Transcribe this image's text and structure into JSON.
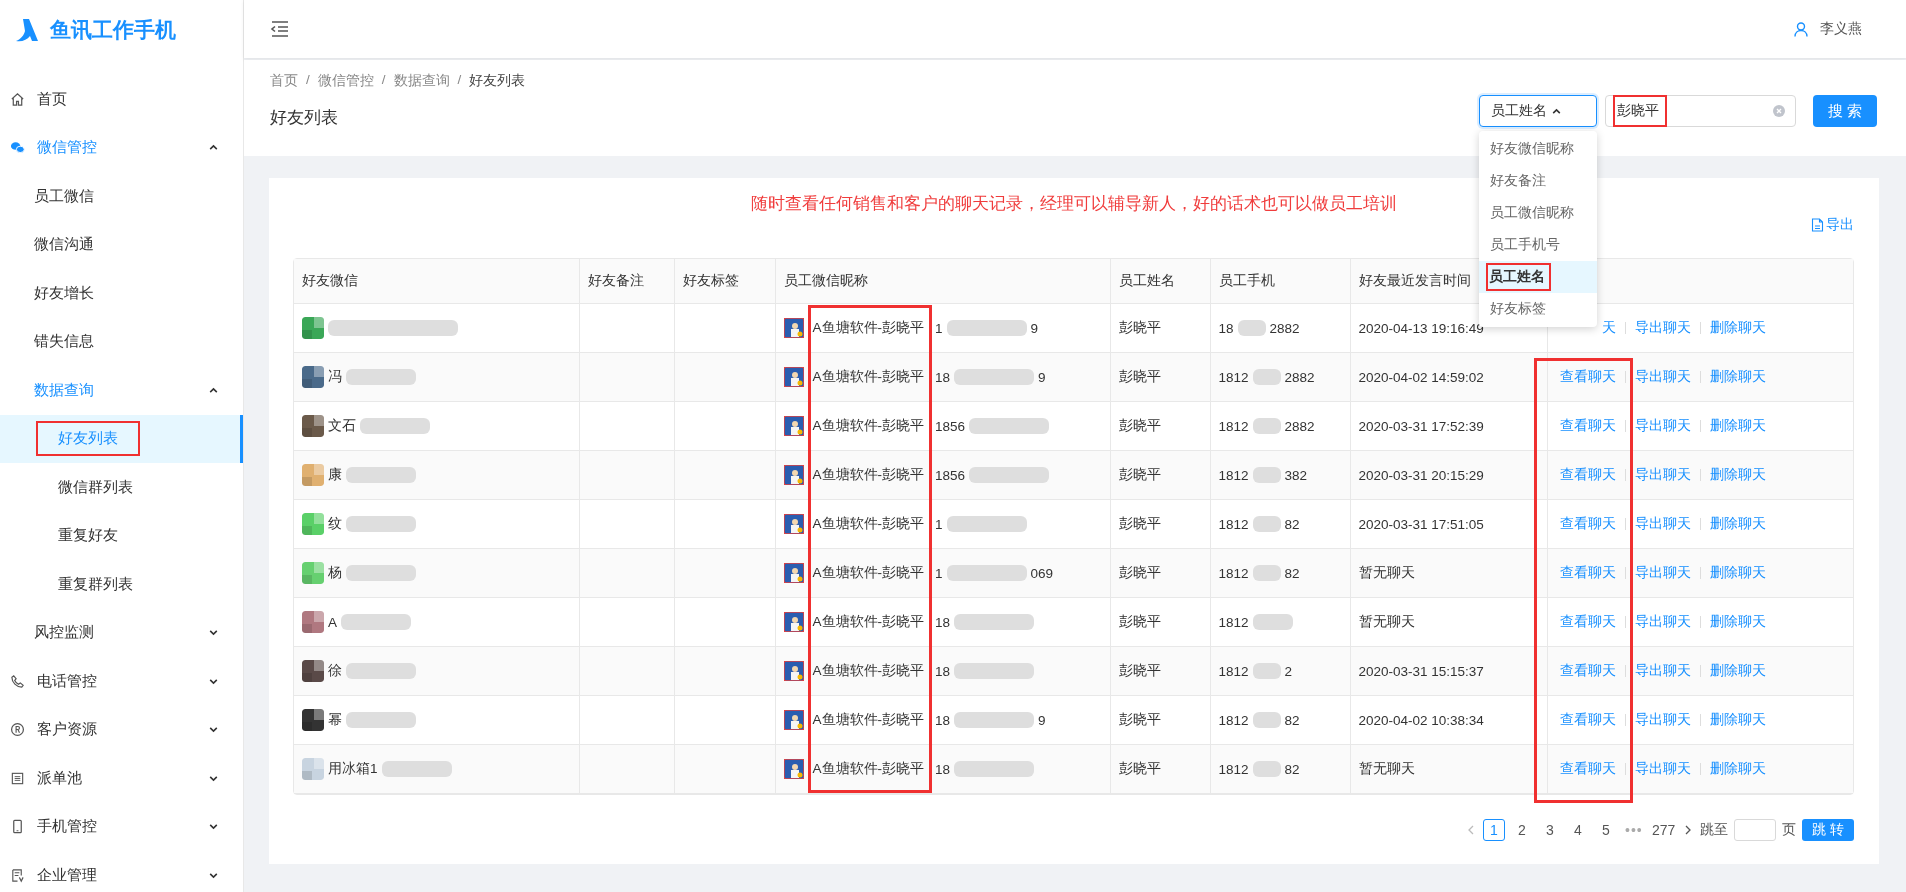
{
  "app": {
    "title": "鱼讯工作手机"
  },
  "sidebar": {
    "items": [
      {
        "label": "首页",
        "selected": false
      },
      {
        "label": "微信管控",
        "selected": false,
        "expanded": true,
        "children": [
          {
            "label": "员工微信",
            "selected": false
          },
          {
            "label": "微信沟通",
            "selected": false
          },
          {
            "label": "好友增长",
            "selected": false
          },
          {
            "label": "错失信息",
            "selected": false
          },
          {
            "label": "数据查询",
            "selected": false,
            "expanded": true,
            "children": [
              {
                "label": "好友列表",
                "selected": true,
                "highlighted": true
              },
              {
                "label": "微信群列表",
                "selected": false
              },
              {
                "label": "重复好友",
                "selected": false
              },
              {
                "label": "重复群列表",
                "selected": false
              }
            ]
          },
          {
            "label": "风控监测",
            "selected": false,
            "expanded": false
          }
        ]
      },
      {
        "label": "电话管控",
        "selected": false,
        "expanded": false
      },
      {
        "label": "客户资源",
        "selected": false,
        "expanded": false
      },
      {
        "label": "派单池",
        "selected": false,
        "expanded": false
      },
      {
        "label": "手机管控",
        "selected": false,
        "expanded": false
      },
      {
        "label": "企业管理",
        "selected": false,
        "expanded": false
      }
    ]
  },
  "header": {
    "user": "李义燕"
  },
  "breadcrumb": {
    "items": [
      "首页",
      "微信管控",
      "数据查询",
      "好友列表"
    ],
    "separators": [
      "/",
      "/",
      "/"
    ]
  },
  "page_title": "好友列表",
  "search": {
    "field": {
      "value": "员工姓名",
      "expanded": true,
      "options": [
        {
          "label": "好友微信昵称",
          "selected": false
        },
        {
          "label": "好友备注",
          "selected": false
        },
        {
          "label": "员工微信昵称",
          "selected": false
        },
        {
          "label": "员工手机号",
          "selected": false
        },
        {
          "label": "员工姓名",
          "selected": true,
          "highlighted": true
        },
        {
          "label": "好友标签",
          "selected": false
        }
      ]
    },
    "query": "彭晓平",
    "query_highlighted": true,
    "button": "搜 索"
  },
  "notice": "随时查看任何销售和客户的聊天记录，经理可以辅导新人，好的话术也可以做员工培训",
  "export": "导出",
  "table": {
    "columns": [
      {
        "label": "好友微信",
        "highlighted": false
      },
      {
        "label": "好友备注",
        "highlighted": false
      },
      {
        "label": "好友标签",
        "highlighted": false
      },
      {
        "label": "员工微信昵称",
        "highlighted": true
      },
      {
        "label": "员工姓名",
        "highlighted": false
      },
      {
        "label": "员工手机",
        "highlighted": false
      },
      {
        "label": "好友最近发言时间",
        "highlighted": false
      },
      {
        "highlighted": true
      }
    ],
    "rows": [
      {
        "nickname": {
          "text": "A鱼塘软件-彭晓平",
          "start": "1",
          "end": "9"
        },
        "employee": "彭晓平",
        "phone": {
          "start": "18",
          "end": "2882"
        },
        "last_message": "2020-04-13 19:16:49",
        "actions": [
          "天",
          "导出聊天",
          "删除聊天"
        ]
      },
      {
        "friend": "冯",
        "nickname": {
          "text": "A鱼塘软件-彭晓平",
          "start": "18",
          "end": "9"
        },
        "employee": "彭晓平",
        "phone": {
          "start": "1812",
          "end": "2882"
        },
        "last_message": "2020-04-02 14:59:02",
        "actions": [
          "查看聊天",
          "导出聊天",
          "删除聊天"
        ]
      },
      {
        "friend": "文石",
        "nickname": {
          "text": "A鱼塘软件-彭晓平",
          "start": "1856"
        },
        "employee": "彭晓平",
        "phone": {
          "start": "1812",
          "end": "2882"
        },
        "last_message": "2020-03-31 17:52:39",
        "actions": [
          "查看聊天",
          "导出聊天",
          "删除聊天"
        ]
      },
      {
        "friend": "康",
        "nickname": {
          "text": "A鱼塘软件-彭晓平",
          "start": "1856"
        },
        "employee": "彭晓平",
        "phone": {
          "start": "1812",
          "end": "382"
        },
        "last_message": "2020-03-31 20:15:29",
        "actions": [
          "查看聊天",
          "导出聊天",
          "删除聊天"
        ]
      },
      {
        "friend": "纹",
        "nickname": {
          "text": "A鱼塘软件-彭晓平",
          "start": "1"
        },
        "employee": "彭晓平",
        "phone": {
          "start": "1812",
          "end": "82"
        },
        "last_message": "2020-03-31 17:51:05",
        "actions": [
          "查看聊天",
          "导出聊天",
          "删除聊天"
        ]
      },
      {
        "friend": "杨",
        "nickname": {
          "text": "A鱼塘软件-彭晓平",
          "start": "1",
          "end": "069"
        },
        "employee": "彭晓平",
        "phone": {
          "start": "1812",
          "end": "82"
        },
        "last_message": "暂无聊天",
        "actions": [
          "查看聊天",
          "导出聊天",
          "删除聊天"
        ]
      },
      {
        "friend": "A",
        "nickname": {
          "text": "A鱼塘软件-彭晓平",
          "start": "18"
        },
        "employee": "彭晓平",
        "phone": {
          "start": "1812"
        },
        "last_message": "暂无聊天",
        "actions": [
          "查看聊天",
          "导出聊天",
          "删除聊天"
        ]
      },
      {
        "friend": "徐",
        "nickname": {
          "text": "A鱼塘软件-彭晓平",
          "start": "18"
        },
        "employee": "彭晓平",
        "phone": {
          "start": "1812",
          "end": "2"
        },
        "last_message": "2020-03-31 15:15:37",
        "actions": [
          "查看聊天",
          "导出聊天",
          "删除聊天"
        ]
      },
      {
        "friend": "幂",
        "nickname": {
          "text": "A鱼塘软件-彭晓平",
          "start": "18",
          "end": "9"
        },
        "employee": "彭晓平",
        "phone": {
          "start": "1812",
          "end": "82"
        },
        "last_message": "2020-04-02 10:38:34",
        "actions": [
          "查看聊天",
          "导出聊天",
          "删除聊天"
        ]
      },
      {
        "friend": "用冰箱1",
        "nickname": {
          "text": "A鱼塘软件-彭晓平",
          "start": "18"
        },
        "employee": "彭晓平",
        "phone": {
          "start": "1812",
          "end": "82"
        },
        "last_message": "暂无聊天",
        "actions": [
          "查看聊天",
          "导出聊天",
          "删除聊天"
        ]
      }
    ]
  },
  "pagination": {
    "pages": [
      {
        "label": "1",
        "selected": true,
        "kind": "page"
      },
      {
        "label": "2",
        "selected": false,
        "kind": "page"
      },
      {
        "label": "3",
        "selected": false,
        "kind": "page"
      },
      {
        "label": "4",
        "selected": false,
        "kind": "page"
      },
      {
        "label": "5",
        "selected": false,
        "kind": "page"
      },
      {
        "label": "•••",
        "selected": false,
        "kind": "ellipsis"
      },
      {
        "label": "277",
        "selected": false,
        "kind": "page"
      }
    ],
    "goto_label": "跳至",
    "page_unit": "页",
    "goto_button": "跳 转"
  }
}
